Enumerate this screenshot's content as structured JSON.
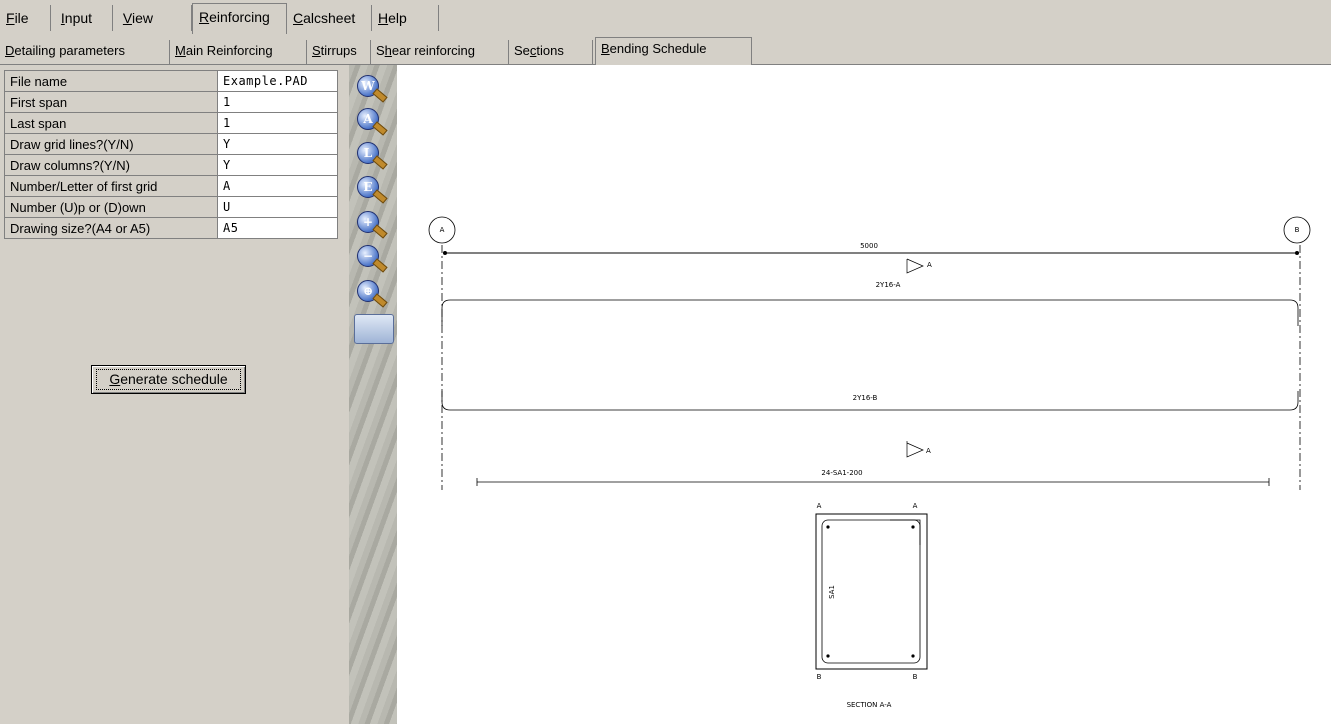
{
  "menu": {
    "items": [
      {
        "pre": "",
        "key": "F",
        "rest": "ile"
      },
      {
        "pre": "",
        "key": "I",
        "rest": "nput"
      },
      {
        "pre": "",
        "key": "V",
        "rest": "iew"
      },
      {
        "pre": "",
        "key": "R",
        "rest": "einforcing"
      },
      {
        "pre": "",
        "key": "C",
        "rest": "alcsheet"
      },
      {
        "pre": "",
        "key": "H",
        "rest": "elp"
      }
    ]
  },
  "subtabs": {
    "items": [
      {
        "pre": "",
        "key": "D",
        "rest": "etailing parameters"
      },
      {
        "pre": "",
        "key": "M",
        "rest": "ain Reinforcing"
      },
      {
        "pre": "",
        "key": "S",
        "rest": "tirrups"
      },
      {
        "pre": "S",
        "key": "h",
        "rest": "ear reinforcing"
      },
      {
        "pre": "Se",
        "key": "c",
        "rest": "tions"
      },
      {
        "pre": "",
        "key": "B",
        "rest": "ending Schedule"
      }
    ]
  },
  "params": {
    "rows": [
      {
        "label": "File name",
        "value": "Example.PAD"
      },
      {
        "label": "First span",
        "value": "1"
      },
      {
        "label": "Last span",
        "value": "1"
      },
      {
        "label": "Draw grid lines?(Y/N)",
        "value": "Y"
      },
      {
        "label": "Draw columns?(Y/N)",
        "value": "Y"
      },
      {
        "label": "Number/Letter of first grid",
        "value": "A"
      },
      {
        "label": "Number (U)p or (D)own",
        "value": "U"
      },
      {
        "label": "Drawing size?(A4 or A5)",
        "value": "A5"
      }
    ]
  },
  "generate": {
    "key": "G",
    "rest": "enerate schedule"
  },
  "toolbar": {
    "icons": [
      "W",
      "A",
      "L",
      "E",
      "+",
      "−",
      "⊕"
    ],
    "icon_names": [
      "zoom-window-icon",
      "zoom-all-icon",
      "zoom-limits-icon",
      "zoom-extents-icon",
      "zoom-in-icon",
      "zoom-out-icon",
      "pan-icon",
      "print-icon"
    ]
  },
  "drawing": {
    "grid_left": "A",
    "grid_right": "B",
    "span_length": "5000",
    "section_marker": "A",
    "top_bar": "2Y16-A",
    "bottom_bar": "2Y16-B",
    "stirrups": "24-SA1-200",
    "corner_a_left": "A",
    "corner_a_right": "A",
    "corner_b_left": "B",
    "corner_b_right": "B",
    "stirrup_label": "SA1",
    "section_title": "SECTION A-A"
  }
}
